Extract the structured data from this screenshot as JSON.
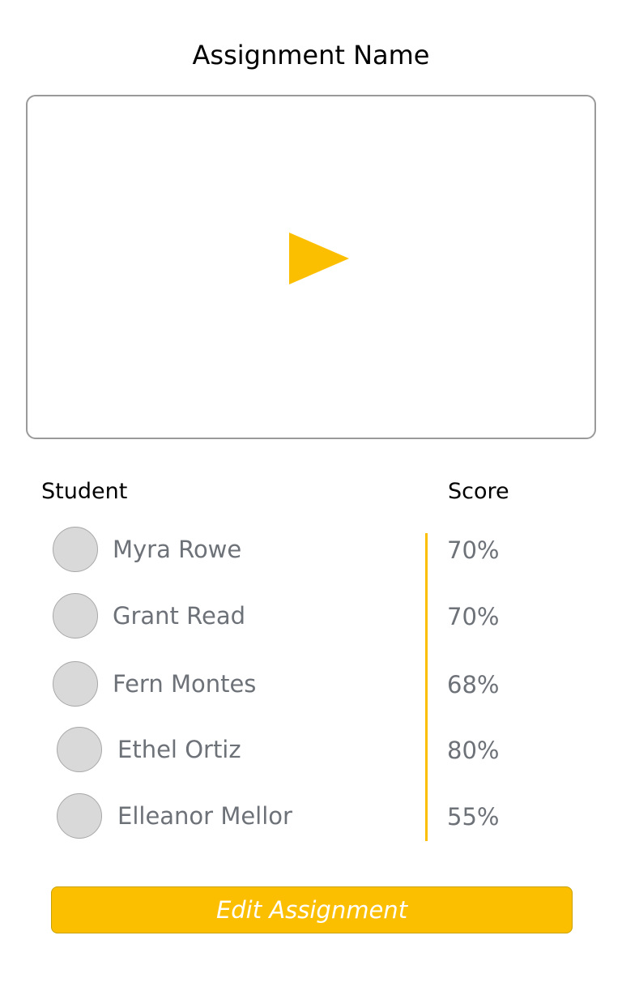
{
  "title": "Assignment Name",
  "video": {
    "play_icon": "play-triangle-icon"
  },
  "table": {
    "student_header": "Student",
    "score_header": "Score",
    "rows": [
      {
        "name": "Myra Rowe",
        "score": "70%"
      },
      {
        "name": "Grant Read",
        "score": "70%"
      },
      {
        "name": "Fern Montes",
        "score": "68%"
      },
      {
        "name": "Ethel Ortiz",
        "score": "80%"
      },
      {
        "name": "Elleanor Mellor",
        "score": "55%"
      }
    ]
  },
  "edit_button_label": "Edit Assignment",
  "colors": {
    "accent": "#fcbf00",
    "text_muted": "#6d7178",
    "avatar": "#d9d9d9",
    "border": "#9a9a9a"
  }
}
